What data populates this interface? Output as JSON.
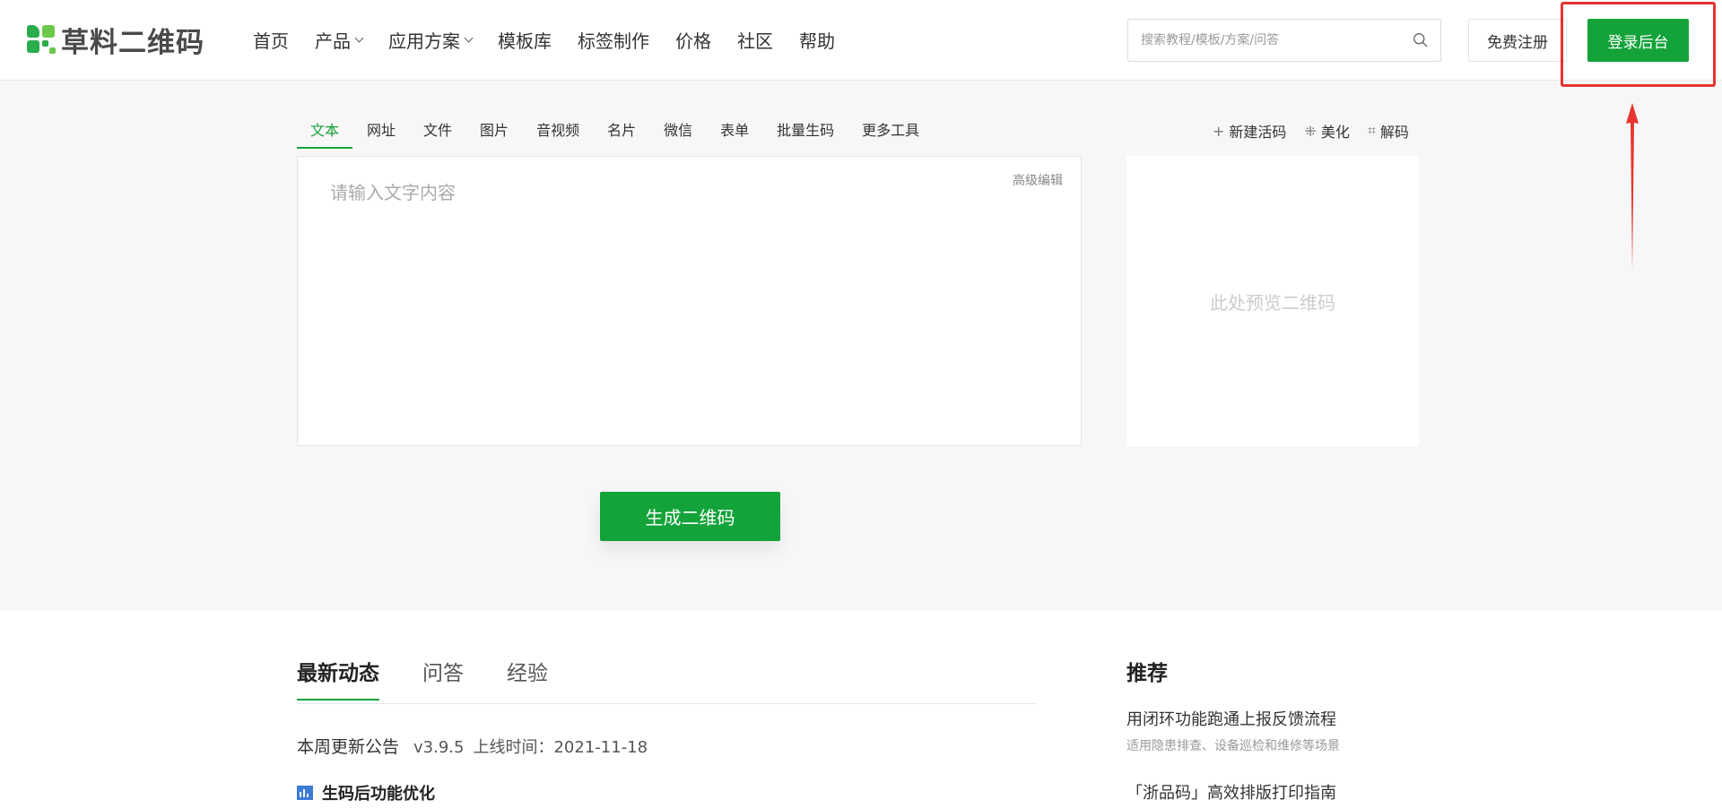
{
  "header": {
    "logo_text": "草料二维码",
    "nav": [
      {
        "label": "首页",
        "dropdown": false
      },
      {
        "label": "产品",
        "dropdown": true
      },
      {
        "label": "应用方案",
        "dropdown": true
      },
      {
        "label": "模板库",
        "dropdown": false
      },
      {
        "label": "标签制作",
        "dropdown": false
      },
      {
        "label": "价格",
        "dropdown": false
      },
      {
        "label": "社区",
        "dropdown": false
      },
      {
        "label": "帮助",
        "dropdown": false
      }
    ],
    "search_placeholder": "搜索教程/模板/方案/问答",
    "register_label": "免费注册",
    "login_label": "登录后台"
  },
  "tools": {
    "tabs": [
      "文本",
      "网址",
      "文件",
      "图片",
      "音视频",
      "名片",
      "微信",
      "表单",
      "批量生码",
      "更多工具"
    ],
    "active_tab": "文本",
    "right": [
      {
        "icon": "plus-icon",
        "glyph": "+",
        "label": "新建活码"
      },
      {
        "icon": "sparkle-icon",
        "glyph": "⁜",
        "label": "美化"
      },
      {
        "icon": "scan-icon",
        "glyph": "⌗",
        "label": "解码"
      }
    ]
  },
  "editor": {
    "placeholder": "请输入文字内容",
    "advanced_label": "高级编辑"
  },
  "preview": {
    "placeholder": "此处预览二维码"
  },
  "generate_label": "生成二维码",
  "news": {
    "tabs": [
      "最新动态",
      "问答",
      "经验"
    ],
    "active_tab": "最新动态",
    "item1_title": "本周更新公告",
    "item1_version": "v3.9.5",
    "item1_date": "上线时间：2021-11-18",
    "item2_title": "生码后功能优化"
  },
  "recommend": {
    "title": "推荐",
    "items": [
      {
        "title": "用闭环功能跑通上报反馈流程",
        "subtitle": "适用隐患排查、设备巡检和维修等场景"
      },
      {
        "title": "「浙品码」高效排版打印指南"
      }
    ]
  },
  "colors": {
    "brand_green": "#14a33a",
    "annotation_red": "#e8332f"
  }
}
